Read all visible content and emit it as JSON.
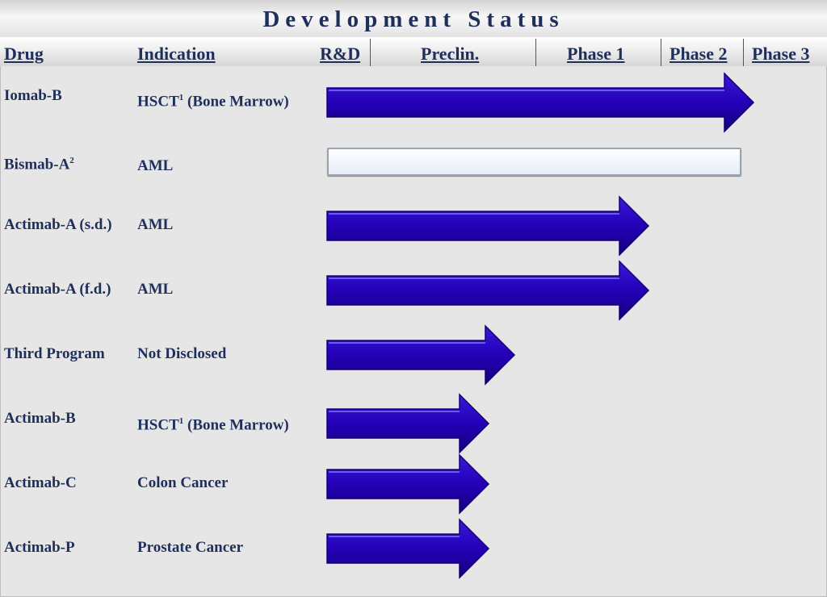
{
  "title": "Development Status",
  "headers": {
    "drug": "Drug",
    "indication": "Indication",
    "rnd": "R&D",
    "preclin": "Preclin.",
    "phase1": "Phase 1",
    "phase2": "Phase 2",
    "phase3": "Phase 3"
  },
  "rows": [
    {
      "drug": "Iomab-B",
      "drug_sup": "",
      "indication": "HSCT",
      "indication_sup": "1",
      "indication_suffix": " (Bone Marrow)",
      "style": "arrow",
      "progress_phase": 3.0
    },
    {
      "drug": "Bismab-A",
      "drug_sup": "2",
      "indication": "AML",
      "indication_sup": "",
      "indication_suffix": "",
      "style": "box",
      "progress_phase": 3.0
    },
    {
      "drug": "Actimab-A (s.d.)",
      "drug_sup": "",
      "indication": "AML",
      "indication_sup": "",
      "indication_suffix": "",
      "style": "arrow",
      "progress_phase": 2.2
    },
    {
      "drug": "Actimab-A (f.d.)",
      "drug_sup": "",
      "indication": "AML",
      "indication_sup": "",
      "indication_suffix": "",
      "style": "arrow",
      "progress_phase": 2.2
    },
    {
      "drug": "Third Program",
      "drug_sup": "",
      "indication": "Not Disclosed",
      "indication_sup": "",
      "indication_suffix": "",
      "style": "arrow",
      "progress_phase": 1.2
    },
    {
      "drug": "Actimab-B",
      "drug_sup": "",
      "indication": "HSCT",
      "indication_sup": "1",
      "indication_suffix": " (Bone Marrow)",
      "style": "arrow",
      "progress_phase": 1.0
    },
    {
      "drug": "Actimab-C",
      "drug_sup": "",
      "indication": "Colon Cancer",
      "indication_sup": "",
      "indication_suffix": "",
      "style": "arrow",
      "progress_phase": 1.0
    },
    {
      "drug": "Actimab-P",
      "drug_sup": "",
      "indication": "Prostate Cancer",
      "indication_sup": "",
      "indication_suffix": "",
      "style": "arrow",
      "progress_phase": 1.0
    }
  ],
  "colors": {
    "arrow_fill": "#2400b8",
    "arrow_dark": "#140070",
    "text": "#1f2f5c",
    "background": "#e6e6e6"
  }
}
